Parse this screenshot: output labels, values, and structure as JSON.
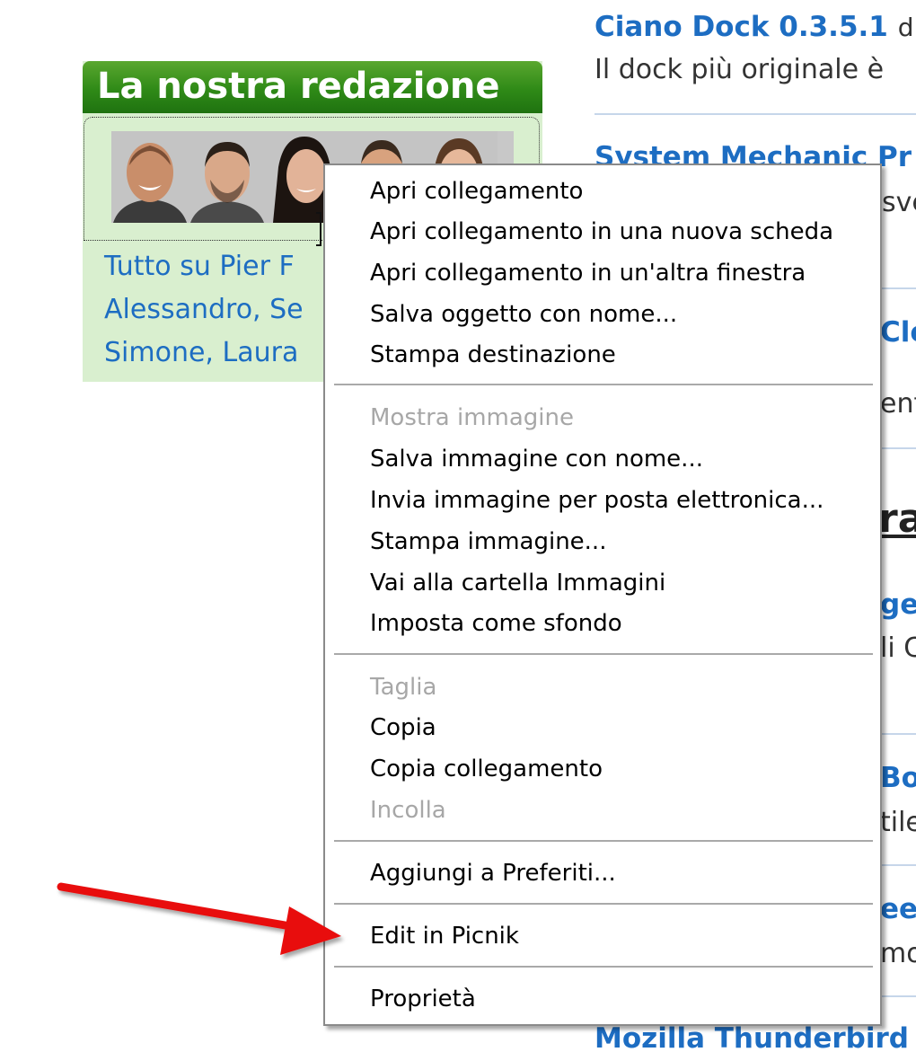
{
  "editorial_box": {
    "title": "La nostra redazione",
    "links": [
      "Tutto su Pier F",
      "Alessandro, Se",
      "Simone, Laura"
    ]
  },
  "right_column": {
    "item1_title": "Ciano Dock 0.3.5.1",
    "item1_title_trail": "d",
    "item1_desc": "Il dock più originale è",
    "item2_title": "System Mechanic Pr",
    "item2_desc": "sve",
    "item3_title": "Cle",
    "item3_desc": "ent",
    "section_heading": "ra",
    "item4_title": "ge",
    "item4_desc": "li C",
    "item5_title": "Bo",
    "item5_desc": "tile",
    "item6_title": "ee",
    "item6_desc": "mo",
    "item7_title": "Mozilla Thunderbird"
  },
  "context_menu": {
    "items": [
      {
        "label": "Apri collegamento",
        "disabled": false
      },
      {
        "label": "Apri collegamento in una nuova scheda",
        "disabled": false
      },
      {
        "label": "Apri collegamento in un'altra finestra",
        "disabled": false
      },
      {
        "label": "Salva oggetto con nome...",
        "disabled": false
      },
      {
        "label": "Stampa destinazione",
        "disabled": false
      },
      {
        "label": "Mostra immagine",
        "disabled": true
      },
      {
        "label": "Salva immagine con nome...",
        "disabled": false
      },
      {
        "label": "Invia immagine per posta elettronica...",
        "disabled": false
      },
      {
        "label": "Stampa immagine...",
        "disabled": false
      },
      {
        "label": "Vai alla cartella Immagini",
        "disabled": false
      },
      {
        "label": "Imposta come sfondo",
        "disabled": false
      },
      {
        "label": "Taglia",
        "disabled": true
      },
      {
        "label": "Copia",
        "disabled": false
      },
      {
        "label": "Copia collegamento",
        "disabled": false
      },
      {
        "label": "Incolla",
        "disabled": true
      },
      {
        "label": "Aggiungi a Preferiti...",
        "disabled": false
      },
      {
        "label": "Edit in Picnik",
        "disabled": false
      },
      {
        "label": "Proprietà",
        "disabled": false
      }
    ]
  },
  "colors": {
    "link_blue": "#1d6dc2",
    "header_green": "#2f8a17",
    "box_bg": "#d9efcf",
    "arrow_red": "#e8100e",
    "disabled_text": "#a7a7a7"
  },
  "icons": [
    "red-arrow-pointer-icon"
  ]
}
